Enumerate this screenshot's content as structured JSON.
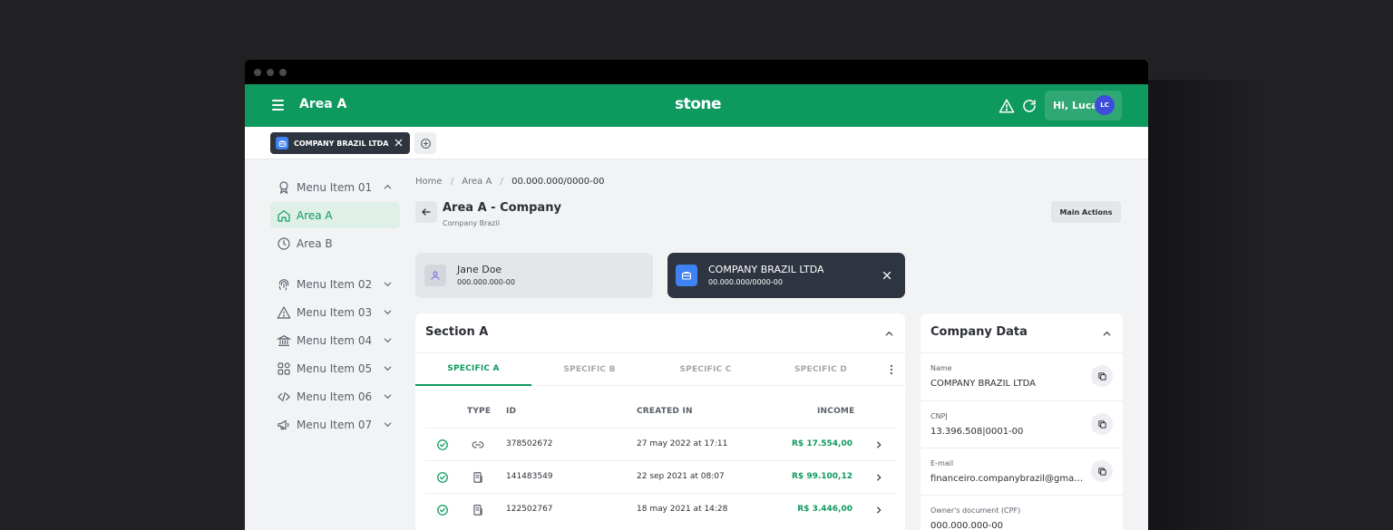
{
  "header": {
    "area_title": "Area A",
    "brand": "stone",
    "greeting": "Hi, Lucas",
    "avatar_initials": "LC",
    "brand_color": "#0e9a5f"
  },
  "tabs": {
    "company_tab_label": "COMPANY BRAZIL LTDA"
  },
  "sidebar": {
    "items": [
      {
        "label": "Menu Item 01",
        "icon": "award-icon",
        "expanded": true
      },
      {
        "label": "Area A",
        "icon": "home-icon",
        "active": true
      },
      {
        "label": "Area B",
        "icon": "clock-icon"
      },
      {
        "label": "Menu Item 02",
        "icon": "fingerprint-icon"
      },
      {
        "label": "Menu Item 03",
        "icon": "alert-triangle-icon"
      },
      {
        "label": "Menu Item 04",
        "icon": "bank-icon"
      },
      {
        "label": "Menu Item 05",
        "icon": "grid-icon"
      },
      {
        "label": "Menu Item 06",
        "icon": "code-icon"
      },
      {
        "label": "Menu Item 07",
        "icon": "megaphone-icon"
      }
    ]
  },
  "breadcrumb": {
    "home": "Home",
    "area": "Area A",
    "current": "00.000.000/0000-00",
    "separator": "/"
  },
  "page": {
    "title": "Area A - Company",
    "subtitle": "Company Brazil",
    "main_actions_label": "Main Actions"
  },
  "person_card": {
    "name": "Jane Doe",
    "document": "000.000.000-00"
  },
  "company_card": {
    "name": "COMPANY BRAZIL LTDA",
    "document": "00.000.000/0000-00"
  },
  "section": {
    "title": "Section A",
    "tabs": [
      "SPECIFIC A",
      "SPECIFIC B",
      "SPECIFIC C",
      "SPECIFIC D"
    ],
    "columns": {
      "type": "TYPE",
      "id": "ID",
      "created": "CREATED IN",
      "income": "INCOME"
    },
    "rows": [
      {
        "type_icon": "link-icon",
        "id": "378502672",
        "created": "27 may 2022 at 17:11",
        "income": "R$ 17.554,00"
      },
      {
        "type_icon": "receipt-icon",
        "id": "141483549",
        "created": "22 sep 2021 at 08:07",
        "income": "R$ 99.100,12"
      },
      {
        "type_icon": "receipt-icon",
        "id": "122502767",
        "created": "18 may 2021 at 14:28",
        "income": "R$ 3.446,00"
      }
    ]
  },
  "company_data": {
    "title": "Company Data",
    "fields": [
      {
        "label": "Name",
        "value": "COMPANY BRAZIL LTDA"
      },
      {
        "label": "CNPJ",
        "value": "13.396.508|0001-00"
      },
      {
        "label": "E-mail",
        "value": "financeiro.companybrazil@gmail..."
      },
      {
        "label": "Owner's document (CPF)",
        "value": "000.000.000-00"
      }
    ]
  }
}
